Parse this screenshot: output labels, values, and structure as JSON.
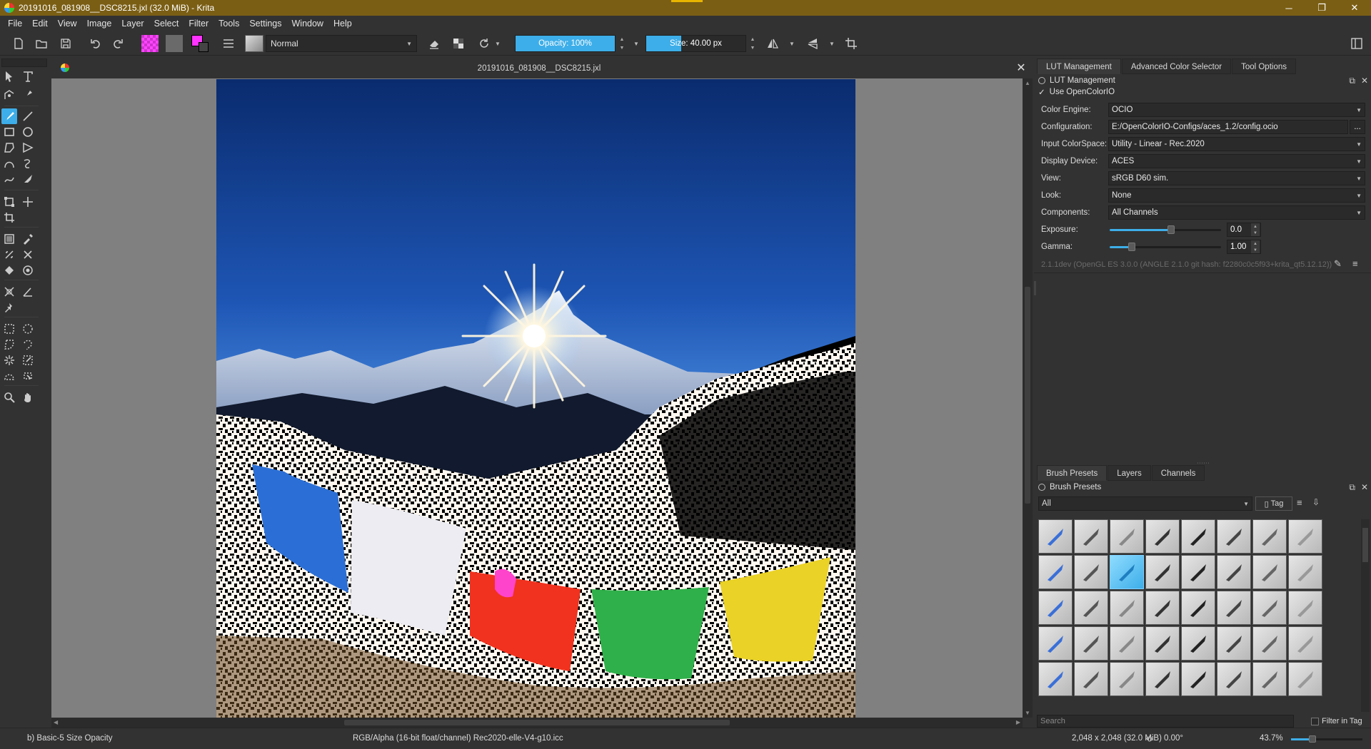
{
  "window": {
    "title": "20191016_081908__DSC8215.jxl (32.0 MiB)  - Krita",
    "minimize": "─",
    "maximize": "❐",
    "close": "✕"
  },
  "menu": [
    "File",
    "Edit",
    "View",
    "Image",
    "Layer",
    "Select",
    "Filter",
    "Tools",
    "Settings",
    "Window",
    "Help"
  ],
  "toolbar": {
    "blend_mode": "Normal",
    "opacity_label": "Opacity: 100%",
    "opacity_fraction": 1.0,
    "size_label": "Size: 40.00 px",
    "size_fraction": 0.35,
    "foreground_color": "#ff33ff",
    "background_color": "#444444"
  },
  "document": {
    "tab_title": "20191016_081908__DSC8215.jxl",
    "close_label": "✕"
  },
  "dock_top": {
    "tabs": [
      "LUT Management",
      "Advanced Color Selector",
      "Tool Options"
    ],
    "active_tab": "LUT Management",
    "panel_title": "LUT Management",
    "use_ocio_label": "Use OpenColorIO",
    "use_ocio_checked": true,
    "rows": {
      "color_engine": {
        "label": "Color Engine:",
        "value": "OCIO"
      },
      "configuration": {
        "label": "Configuration:",
        "value": "E:/OpenColorIO-Configs/aces_1.2/config.ocio",
        "browse": "..."
      },
      "input_colorspace": {
        "label": "Input ColorSpace:",
        "value": "Utility - Linear - Rec.2020"
      },
      "display_device": {
        "label": "Display Device:",
        "value": "ACES"
      },
      "view": {
        "label": "View:",
        "value": "sRGB D60 sim."
      },
      "look": {
        "label": "Look:",
        "value": "None"
      },
      "components": {
        "label": "Components:",
        "value": "All Channels"
      },
      "exposure": {
        "label": "Exposure:",
        "value": "0.0",
        "fraction": 0.55
      },
      "gamma": {
        "label": "Gamma:",
        "value": "1.00",
        "fraction": 0.2
      }
    },
    "version": "2.1.1dev (OpenGL ES 3.0.0 (ANGLE 2.1.0 git hash: f2280c0c5f93+krita_qt5.12.12))"
  },
  "dock_bottom": {
    "tabs": [
      "Brush Presets",
      "Layers",
      "Channels"
    ],
    "active_tab": "Brush Presets",
    "panel_title": "Brush Presets",
    "filter_value": "All",
    "tag_label": "Tag",
    "search_placeholder": "Search",
    "filter_in_tag_label": "Filter in Tag",
    "selected_index": 10
  },
  "status": {
    "brush": "b) Basic-5 Size Opacity",
    "color_model": "RGB/Alpha (16-bit float/channel)  Rec2020-elle-V4-g10.icc",
    "dimensions": "2,048 x 2,048 (32.0 MiB)",
    "rotation": "0.00°",
    "zoom": "43.7%",
    "zoom_fraction": 0.3
  },
  "colors": {
    "accent": "#3daee9",
    "titlebar": "#7a5e14",
    "chrome": "#323232",
    "canvas_bg": "#808080"
  }
}
